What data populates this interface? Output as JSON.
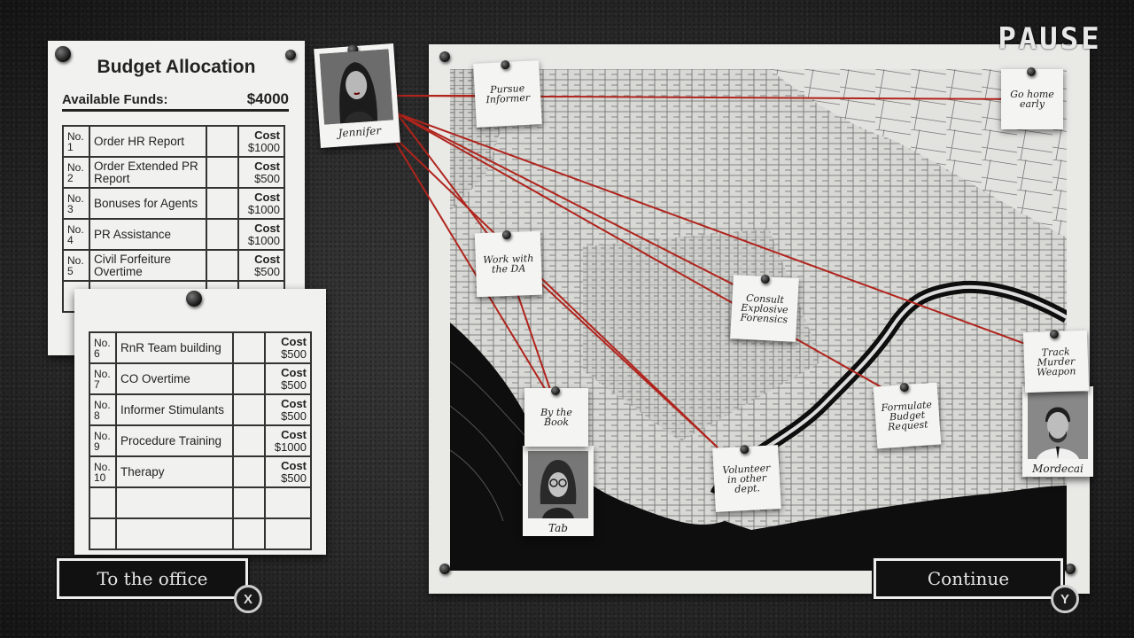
{
  "hud": {
    "pause_label": "PAUSE"
  },
  "budget": {
    "title": "Budget Allocation",
    "funds_label": "Available Funds:",
    "funds_value": "$4000",
    "items": [
      {
        "no": "No.",
        "num": "1",
        "name": "Order HR Report",
        "cost_label": "Cost",
        "cost": "$1000"
      },
      {
        "no": "No.",
        "num": "2",
        "name": "Order Extended PR Report",
        "cost_label": "Cost",
        "cost": "$500"
      },
      {
        "no": "No.",
        "num": "3",
        "name": "Bonuses for Agents",
        "cost_label": "Cost",
        "cost": "$1000"
      },
      {
        "no": "No.",
        "num": "4",
        "name": "PR Assistance",
        "cost_label": "Cost",
        "cost": "$1000"
      },
      {
        "no": "No.",
        "num": "5",
        "name": "Civil Forfeiture Overtime",
        "cost_label": "Cost",
        "cost": "$500"
      },
      {
        "no": "No.",
        "num": "6",
        "name": "RnR Team building",
        "cost_label": "Cost",
        "cost": "$500"
      },
      {
        "no": "No.",
        "num": "7",
        "name": "CO Overtime",
        "cost_label": "Cost",
        "cost": "$500"
      },
      {
        "no": "No.",
        "num": "8",
        "name": "Informer Stimulants",
        "cost_label": "Cost",
        "cost": "$500"
      },
      {
        "no": "No.",
        "num": "9",
        "name": "Procedure Training",
        "cost_label": "Cost",
        "cost": "$1000"
      },
      {
        "no": "No.",
        "num": "10",
        "name": "Therapy",
        "cost_label": "Cost",
        "cost": "$500"
      }
    ]
  },
  "agents": {
    "jennifer": "Jennifer",
    "tab": "Tab",
    "mordecai": "Mordecai"
  },
  "notes": {
    "pursue_informer": "Pursue Informer",
    "go_home_early": "Go home early",
    "work_with_da": "Work with the DA",
    "consult_forensics": "Consult Explosive Forensics",
    "track_weapon": "Track Murder Weapon",
    "by_the_book": "By the Book",
    "formulate_budget": "Formulate Budget Request",
    "volunteer": "Volunteer in other dept."
  },
  "actions": {
    "office_label": "To the office",
    "office_key": "X",
    "continue_label": "Continue",
    "continue_key": "Y"
  },
  "colors": {
    "string": "#b0241c",
    "button_bg": "#111111",
    "paper": "#f1f1ef"
  }
}
